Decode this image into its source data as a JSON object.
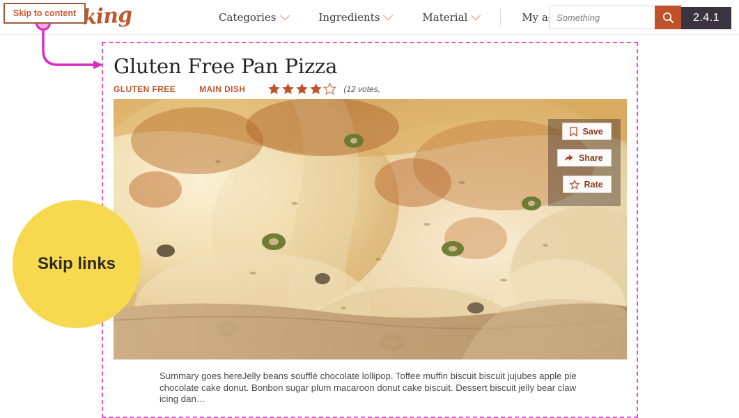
{
  "header": {
    "skip_link": {
      "label": "Skip to content",
      "icon": "skip-link"
    },
    "logo": {
      "text": "king",
      "icon": "site-logo"
    },
    "nav": [
      {
        "label": "Categories",
        "icon": "chevron-down-icon"
      },
      {
        "label": "Ingredients",
        "icon": "chevron-down-icon"
      },
      {
        "label": "Material",
        "icon": "chevron-down-icon"
      },
      {
        "label": "My account",
        "icon": "chevron-down-icon"
      }
    ],
    "search": {
      "value": "",
      "placeholder": "Something",
      "button_icon": "search-icon",
      "accent": "#c0522a"
    },
    "version": {
      "label": "2.4.1",
      "background": "#3b3440"
    }
  },
  "recipe": {
    "title": "Gluten Free Pan Pizza",
    "tags": [
      {
        "label": "GLUTEN FREE"
      },
      {
        "label": "MAIN DISH"
      }
    ],
    "rating": {
      "filled": 4,
      "total": 5,
      "star_color": "#c0522a",
      "votes_text": "(12 votes,"
    },
    "image_alt": "gluten free pan pizza closeup",
    "actions": [
      {
        "label": "Save",
        "icon": "bookmark-icon"
      },
      {
        "label": "Share",
        "icon": "share-arrow-icon"
      },
      {
        "label": "Rate",
        "icon": "star-outline-icon"
      }
    ],
    "summary": "Summary goes hereJelly beans soufflé chocolate lollipop. Toffee muffin biscuit biscuit jujubes apple pie chocolate cake donut. Bonbon sugar plum macaroon donut cake biscuit. Dessert biscuit jelly bear claw icing dan…"
  },
  "annotation": {
    "callout_label": "Skip links",
    "callout_color": "#f7d94f",
    "arrow_color": "#d829c0",
    "content_outline_color": "#e451c8"
  }
}
